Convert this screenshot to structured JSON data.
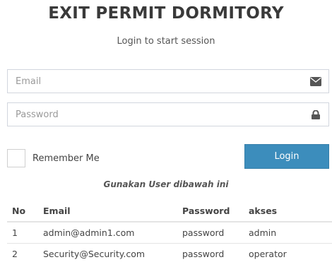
{
  "header": {
    "title": "EXIT PERMIT DORMITORY",
    "subtitle": "Login to start session"
  },
  "form": {
    "email": {
      "placeholder": "Email",
      "value": "",
      "icon": "envelope-icon"
    },
    "password": {
      "placeholder": "Password",
      "value": "",
      "icon": "lock-icon"
    },
    "remember_label": "Remember Me",
    "login_label": "Login"
  },
  "hint": "Gunakan User dibawah ini",
  "users_table": {
    "headers": [
      "No",
      "Email",
      "Password",
      "akses"
    ],
    "rows": [
      [
        "1",
        "admin@admin1.com",
        "password",
        "admin"
      ],
      [
        "2",
        "Security@Security.com",
        "password",
        "operator"
      ]
    ]
  },
  "colors": {
    "accent": "#3c8dbc",
    "border": "#d2d6de"
  }
}
